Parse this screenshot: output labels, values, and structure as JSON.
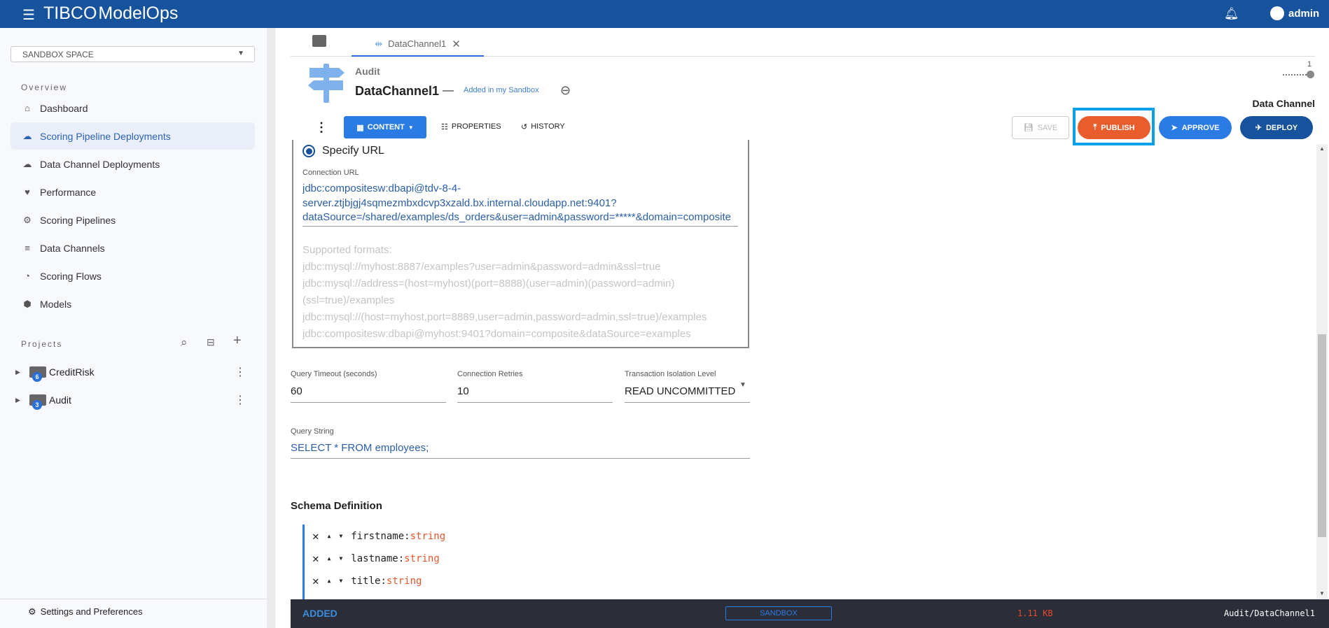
{
  "header": {
    "brand": "TIBCO",
    "product": "ModelOps",
    "user": "admin"
  },
  "sidebar": {
    "space_select": "SANDBOX SPACE",
    "overview_label": "Overview",
    "items": [
      {
        "label": "Dashboard",
        "icon": "home-icon"
      },
      {
        "label": "Scoring Pipeline Deployments",
        "icon": "cloud-upload-icon",
        "active": true
      },
      {
        "label": "Data Channel Deployments",
        "icon": "cloud-upload-icon"
      },
      {
        "label": "Performance",
        "icon": "heart-pulse-icon"
      },
      {
        "label": "Scoring Pipelines",
        "icon": "pipeline-icon"
      },
      {
        "label": "Data Channels",
        "icon": "database-icon"
      },
      {
        "label": "Scoring Flows",
        "icon": "gauge-icon"
      },
      {
        "label": "Models",
        "icon": "cube-icon"
      }
    ],
    "projects_label": "Projects",
    "projects": [
      {
        "name": "CreditRisk",
        "count": "6"
      },
      {
        "name": "Audit",
        "count": "3"
      }
    ],
    "settings": "Settings and Preferences"
  },
  "tabs": {
    "active": "DataChannel1"
  },
  "artifact": {
    "project": "Audit",
    "name": "DataChannel1",
    "dash": "—",
    "status_link": "Added in my Sandbox",
    "version": "1",
    "type": "Data Channel"
  },
  "toolbar": {
    "content": "CONTENT",
    "properties": "PROPERTIES",
    "history": "HISTORY",
    "save": "SAVE",
    "publish": "PUBLISH",
    "approve": "APPROVE",
    "deploy": "DEPLOY"
  },
  "form": {
    "radio_label": "Specify URL",
    "conn_label": "Connection URL",
    "conn_lines": [
      "jdbc:compositesw:dbapi@tdv-8-4-",
      "server.ztjbjgj4sqmezmbxdcvp3xzald.bx.internal.cloudapp.net:9401?",
      "dataSource=/shared/examples/ds_orders&user=admin&password=*****&domain=composite"
    ],
    "formats": [
      "Supported formats:",
      "jdbc:mysql://myhost:8887/examples?user=admin&password=admin&ssl=true",
      "jdbc:mysql://address=(host=myhost)(port=8888)(user=admin)(password=admin)",
      "(ssl=true)/examples",
      "jdbc:mysql://(host=myhost,port=8889,user=admin,password=admin,ssl=true)/examples",
      "jdbc:compositesw:dbapi@myhost:9401?domain=composite&dataSource=examples"
    ],
    "timeout_label": "Query Timeout (seconds)",
    "timeout": "60",
    "retries_label": "Connection Retries",
    "retries": "10",
    "isolation_label": "Transaction Isolation Level",
    "isolation": "READ UNCOMMITTED",
    "query_label": "Query String",
    "query": "SELECT * FROM employees;"
  },
  "schema": {
    "title": "Schema Definition",
    "fields": [
      {
        "name": "firstname",
        "type": "string"
      },
      {
        "name": "lastname",
        "type": "string"
      },
      {
        "name": "title",
        "type": "string"
      }
    ]
  },
  "status": {
    "state": "ADDED",
    "space": "SANDBOX",
    "size": "1.11 KB",
    "path": "Audit/DataChannel1"
  }
}
